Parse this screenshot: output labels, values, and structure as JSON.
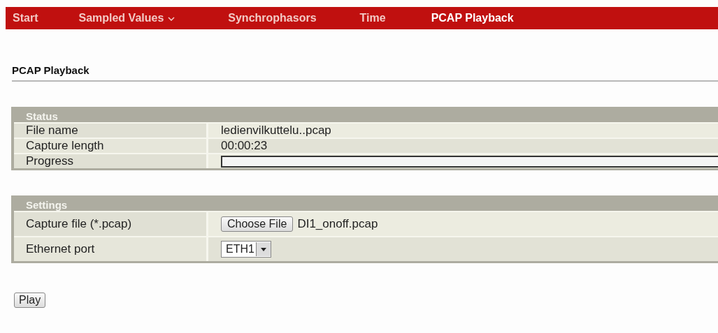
{
  "nav": [
    {
      "label": "Start",
      "selected": false,
      "dropdown": false
    },
    {
      "label": "Sampled Values",
      "selected": false,
      "dropdown": true
    },
    {
      "label": "Synchrophasors",
      "selected": false,
      "dropdown": false
    },
    {
      "label": "Time",
      "selected": false,
      "dropdown": false
    },
    {
      "label": "PCAP Playback",
      "selected": true,
      "dropdown": false
    }
  ],
  "page_title": "PCAP Playback",
  "status": {
    "title": "Status",
    "rows": [
      {
        "kind": "text",
        "label": "File name",
        "value": "ledienvilkuttelu..pcap"
      },
      {
        "kind": "text",
        "label": "Capture length",
        "value": "00:00:23"
      },
      {
        "kind": "progress",
        "label": "Progress",
        "level": 0
      }
    ]
  },
  "settings": {
    "title": "Settings",
    "rows": [
      {
        "kind": "file",
        "label": "Capture file (*.pcap)",
        "button": "Choose File",
        "value": "DI1_onoff.pcap"
      },
      {
        "kind": "select",
        "label": "Ethernet port",
        "value": "ETH1"
      }
    ]
  },
  "play_button": "Play"
}
